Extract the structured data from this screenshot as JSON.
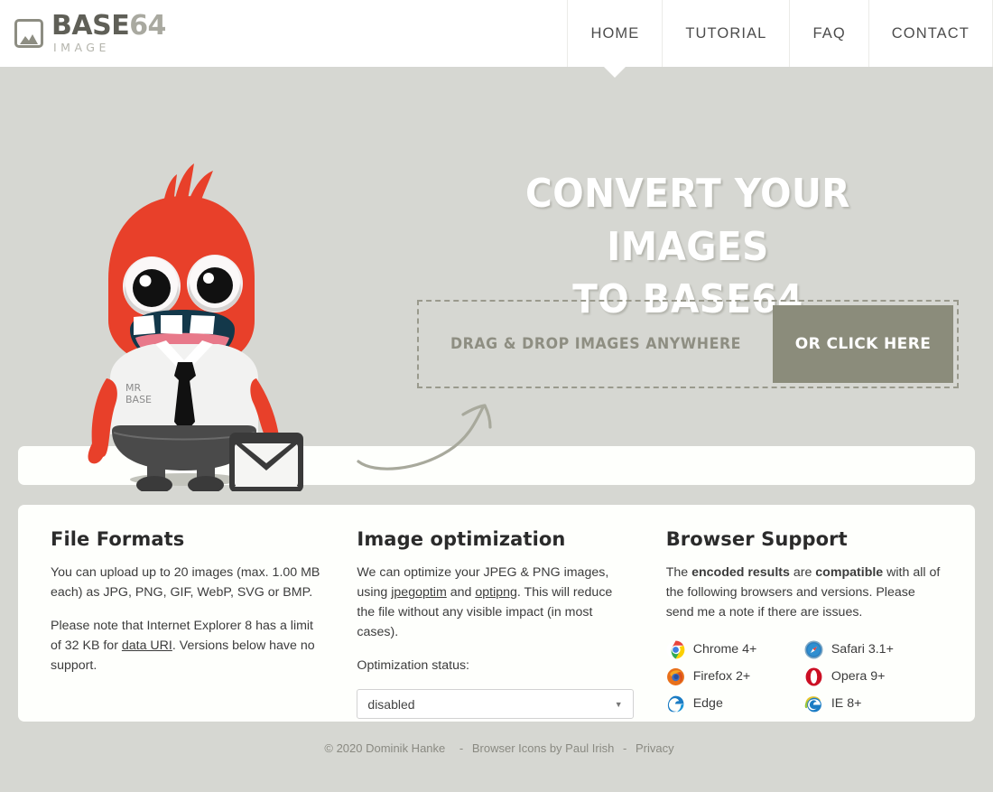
{
  "brand": {
    "title_main": "BASE",
    "title_num": "64",
    "subtitle": "IMAGE",
    "logo_icon": "picture-icon"
  },
  "nav": {
    "items": [
      {
        "label": "HOME",
        "active": true
      },
      {
        "label": "TUTORIAL",
        "active": false
      },
      {
        "label": "FAQ",
        "active": false
      },
      {
        "label": "CONTACT",
        "active": false
      }
    ]
  },
  "hero": {
    "title_line1": "CONVERT YOUR IMAGES",
    "title_line2": "TO BASE64",
    "mascot_alt": "mr-base-mascot",
    "mascot_shirt_text_line1": "MR",
    "mascot_shirt_text_line2": "BASE",
    "dropzone_text": "DRAG & DROP IMAGES ANYWHERE",
    "dropzone_button": "OR CLICK HERE",
    "accent_button_color": "#8b8c7b",
    "page_background": "#d6d7d2"
  },
  "cards": {
    "file_formats": {
      "heading": "File Formats",
      "p1": "You can upload up to 20 images (max. 1.00 MB each) as JPG, PNG, GIF, WebP, SVG or BMP.",
      "p2_before": "Please note that Internet Explorer 8 has a limit of 32 KB for ",
      "p2_link": "data URI",
      "p2_after": ". Versions below have no support."
    },
    "image_optimization": {
      "heading": "Image optimization",
      "p1_before": "We can optimize your JPEG & PNG images, using ",
      "p1_link1": "jpegoptim",
      "p1_mid": " and ",
      "p1_link2": "optipng",
      "p1_after": ". This will reduce the file without any visible impact (in most cases).",
      "select_label": "Optimization status:",
      "select_value": "disabled",
      "select_options": [
        "disabled"
      ]
    },
    "browser_support": {
      "heading": "Browser Support",
      "p1_a": "The ",
      "p1_b1": "encoded results",
      "p1_c": " are ",
      "p1_b2": "compatible",
      "p1_d": " with all of the following browsers and versions. Please send me a note if there are issues.",
      "browsers_left": [
        {
          "name": "Chrome 4+",
          "icon": "chrome-icon"
        },
        {
          "name": "Firefox 2+",
          "icon": "firefox-icon"
        },
        {
          "name": "Edge",
          "icon": "edge-icon"
        }
      ],
      "browsers_right": [
        {
          "name": "Safari 3.1+",
          "icon": "safari-icon"
        },
        {
          "name": "Opera 9+",
          "icon": "opera-icon"
        },
        {
          "name": "IE 8+",
          "icon": "internet-explorer-icon"
        }
      ]
    }
  },
  "footer": {
    "copyright": "© 2020 Dominik Hanke",
    "sep1": "-",
    "credit": "Browser Icons by Paul Irish",
    "sep2": "-",
    "privacy": "Privacy"
  }
}
